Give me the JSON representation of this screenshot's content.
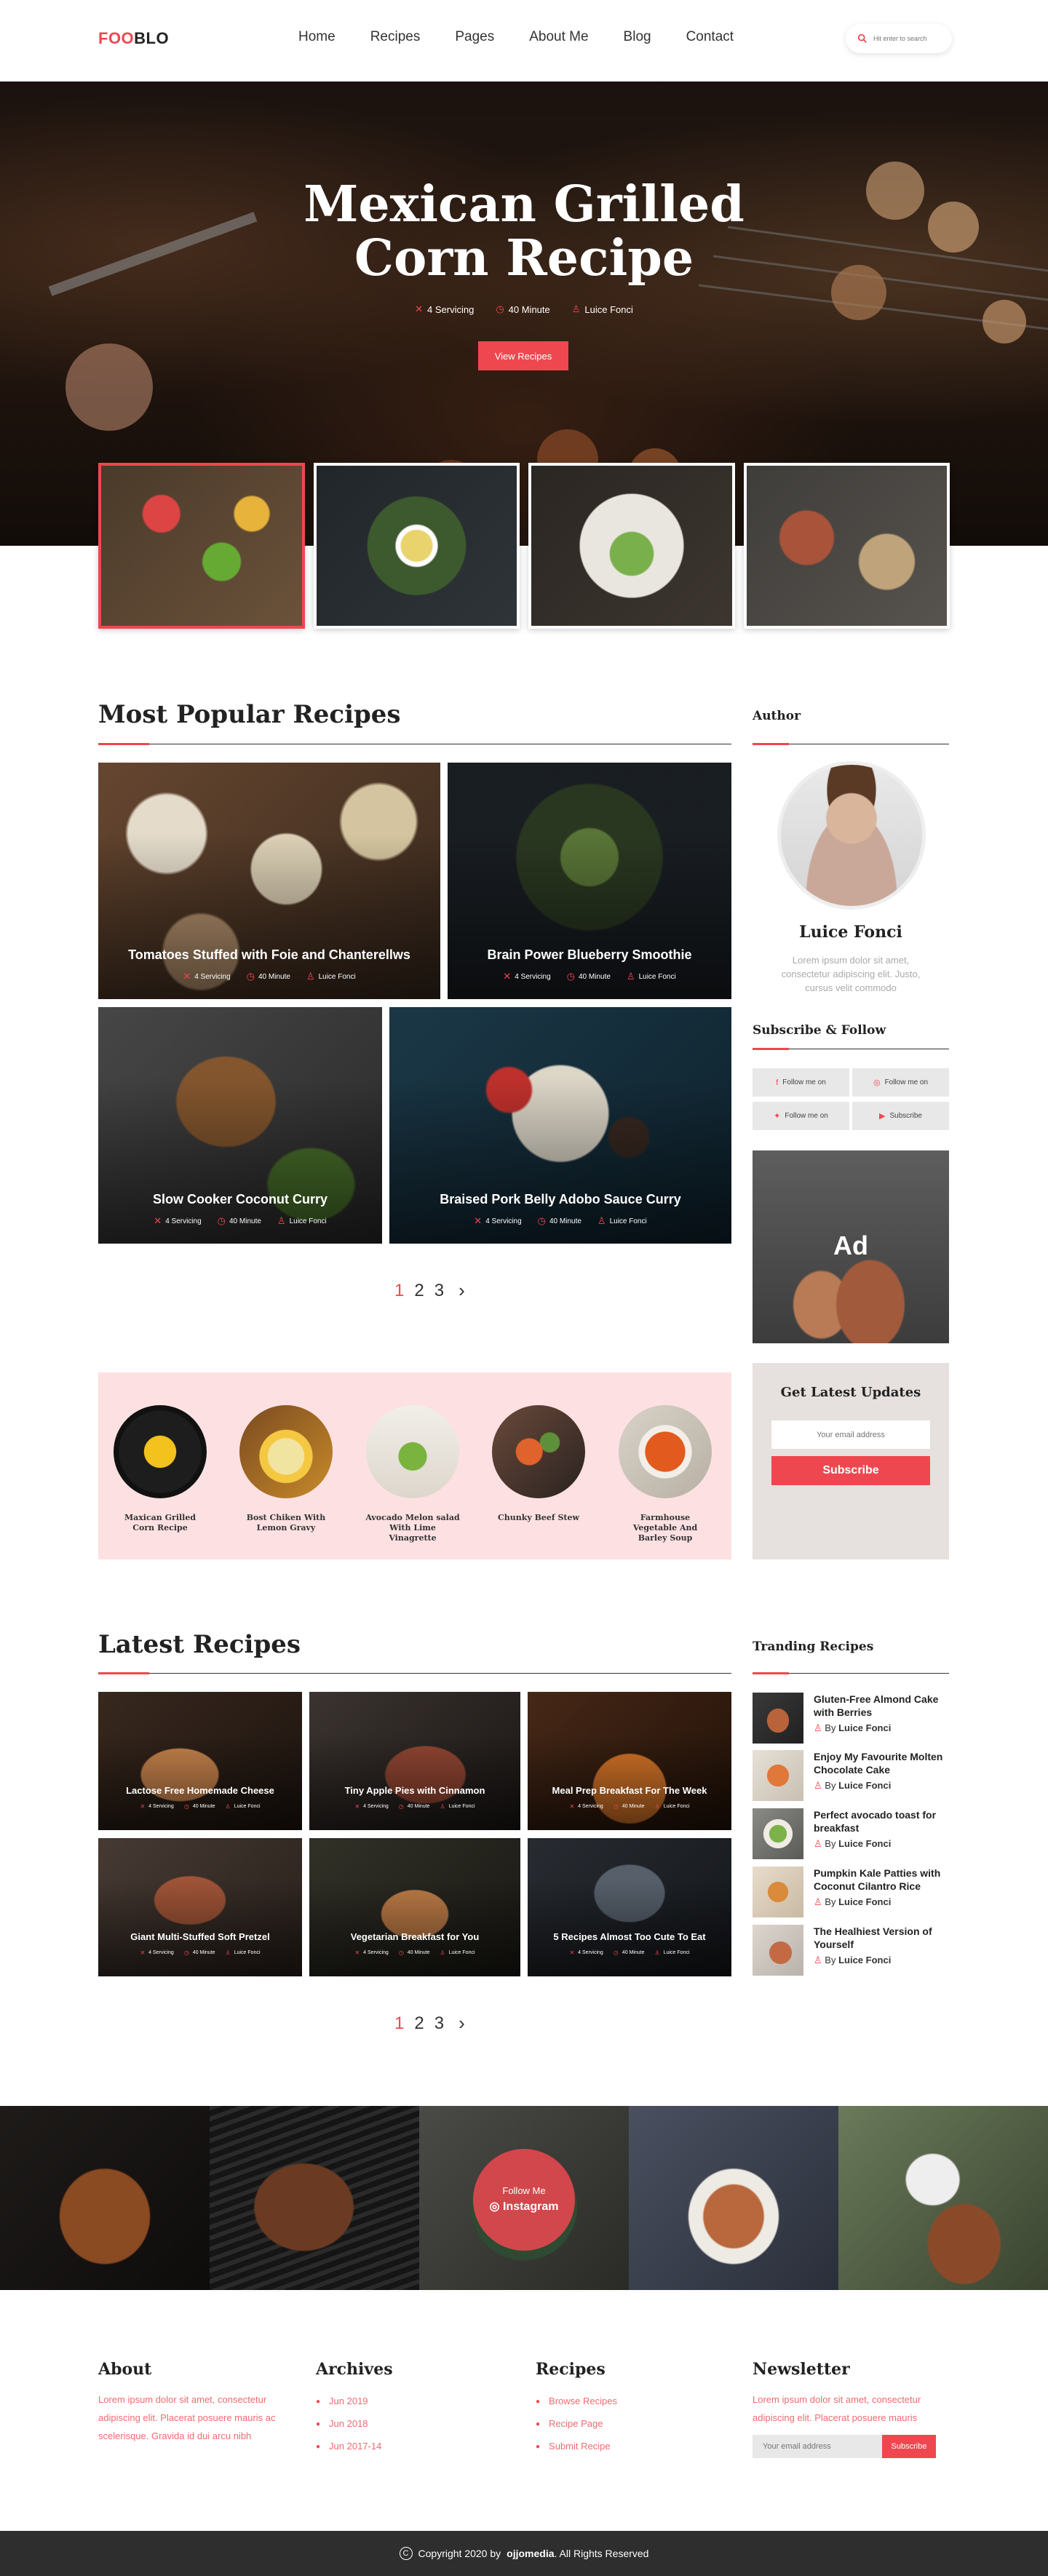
{
  "brand": {
    "logo_part1": "FOO",
    "logo_part2": "BLO"
  },
  "nav": {
    "items": [
      "Home",
      "Recipes",
      "Pages",
      "About Me",
      "Blog",
      "Contact"
    ]
  },
  "search": {
    "placeholder": "Hit enter to search"
  },
  "hero": {
    "title_line1": "Mexican Grilled",
    "title_line2": "Corn Recipe",
    "servings": "4 Servicing",
    "time": "40 Minute",
    "author": "Luice Fonci",
    "button": "View Recipes"
  },
  "popular": {
    "title": "Most Popular Recipes",
    "cards": [
      {
        "title": "Tomatoes Stuffed with Foie and Chanterellws",
        "servings": "4 Servicing",
        "time": "40 Minute",
        "author": "Luice Fonci"
      },
      {
        "title": "Brain Power Blueberry Smoothie",
        "servings": "4 Servicing",
        "time": "40 Minute",
        "author": "Luice Fonci"
      },
      {
        "title": "Slow Cooker Coconut Curry",
        "servings": "4 Servicing",
        "time": "40 Minute",
        "author": "Luice Fonci"
      },
      {
        "title": "Braised Pork Belly Adobo Sauce Curry",
        "servings": "4 Servicing",
        "time": "40 Minute",
        "author": "Luice Fonci"
      }
    ],
    "pages": [
      "1",
      "2",
      "3"
    ],
    "next": "›"
  },
  "author": {
    "title": "Author",
    "name": "Luice Fonci",
    "bio": "Lorem ipsum dolor sit amet, consectetur adipiscing elit. Justo, cursus velit commodo"
  },
  "subscribe": {
    "title": "Subscribe & Follow",
    "buttons": [
      "Follow me on",
      "Follow me on",
      "Follow me on",
      "Subscribe"
    ]
  },
  "ad": {
    "label": "Ad"
  },
  "updates": {
    "title": "Get Latest Updates",
    "placeholder": "Your email address",
    "button": "Subscribe"
  },
  "categories": [
    {
      "label": "Maxican Grilled Corn Recipe"
    },
    {
      "label": "Bost Chiken With Lemon Gravy"
    },
    {
      "label": "Avocado Melon salad With Lime Vinagrette"
    },
    {
      "label": "Chunky Beef Stew"
    },
    {
      "label": "Farmhouse Vegetable And Barley Soup"
    }
  ],
  "latest": {
    "title": "Latest Recipes",
    "cards": [
      {
        "title": "Lactose Free Homemade Cheese",
        "servings": "4 Servicing",
        "time": "40 Minute",
        "author": "Luice Fonci"
      },
      {
        "title": "Tiny Apple Pies with Cinnamon",
        "servings": "4 Servicing",
        "time": "40 Minute",
        "author": "Luice Fonci"
      },
      {
        "title": "Meal Prep Breakfast For The Week",
        "servings": "4 Servicing",
        "time": "40 Minute",
        "author": "Luice Fonci"
      },
      {
        "title": "Giant Multi-Stuffed Soft Pretzel",
        "servings": "4 Servicing",
        "time": "40 Minute",
        "author": "Luice Fonci"
      },
      {
        "title": "Vegetarian Breakfast for You",
        "servings": "4 Servicing",
        "time": "40 Minute",
        "author": "Luice Fonci"
      },
      {
        "title": "5 Recipes Almost Too Cute To Eat",
        "servings": "4 Servicing",
        "time": "40 Minute",
        "author": "Luice Fonci"
      }
    ],
    "pages": [
      "1",
      "2",
      "3"
    ],
    "next": "›"
  },
  "trending": {
    "title": "Tranding Recipes",
    "by": "By",
    "items": [
      {
        "title": "Gluten-Free Almond Cake with Berries",
        "author": "Luice Fonci"
      },
      {
        "title": "Enjoy My Favourite Molten Chocolate Cake",
        "author": "Luice Fonci"
      },
      {
        "title": "Perfect avocado toast for breakfast",
        "author": "Luice Fonci"
      },
      {
        "title": "Pumpkin Kale Patties with Coconut Cilantro Rice",
        "author": "Luice Fonci"
      },
      {
        "title": "The Healhiest Version of Yourself",
        "author": "Luice Fonci"
      }
    ]
  },
  "instagram": {
    "line1": "Follow Me",
    "line2": "Instagram"
  },
  "footer": {
    "about_title": "About",
    "about_text": "Lorem ipsum dolor sit amet, consectetur adipiscing elit. Placerat posuere mauris ac scelerisque. Gravida id dui arcu nibh",
    "archives_title": "Archives",
    "archives": [
      "Jun 2019",
      "Jun 2018",
      "Jun 2017-14"
    ],
    "recipes_title": "Recipes",
    "recipes": [
      "Browse Recipes",
      "Recipe Page",
      "Submit Recipe"
    ],
    "newsletter_title": "Newsletter",
    "newsletter_text": "Lorem ipsum dolor sit amet, consectetur adipiscing elit. Placerat posuere mauris",
    "newsletter_placeholder": "Your email address",
    "newsletter_button": "Subscribe"
  },
  "copyright": {
    "prefix": "Copyright 2020 by",
    "brand": "ojjomedia",
    "suffix": ". All Rights Reserved"
  },
  "colors": {
    "accent": "#ef4750",
    "category_band": "#fde1e2",
    "updates_box": "#e6e0de",
    "footer_bar": "#2e2e2e"
  }
}
